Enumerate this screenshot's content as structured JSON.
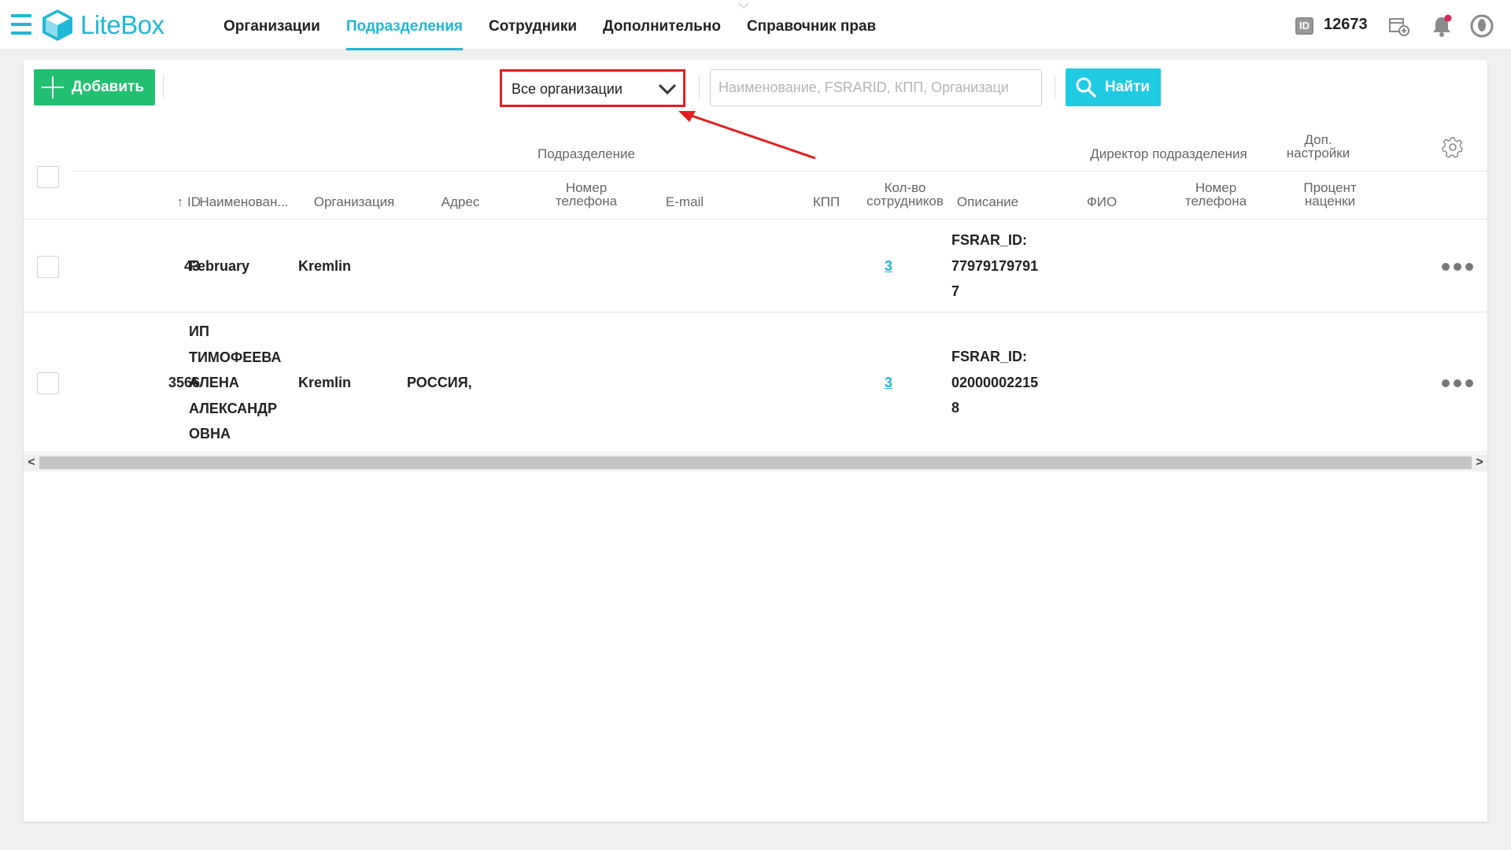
{
  "app": {
    "logo_text": "LiteBox",
    "brand_color": "#1fb8d6"
  },
  "nav": {
    "items": [
      {
        "label": "Организации"
      },
      {
        "label": "Подразделения"
      },
      {
        "label": "Сотрудники"
      },
      {
        "label": "Дополнительно"
      },
      {
        "label": "Справочник прав"
      }
    ],
    "active_index": 1
  },
  "header_right": {
    "id_badge": "ID",
    "id_value": "12673",
    "icons": [
      "add-store-icon",
      "bell-icon",
      "user-avatar-icon"
    ]
  },
  "toolbar": {
    "add_label": "Добавить",
    "org_select_value": "Все организации",
    "search_placeholder": "Наименование, FSRARID, КПП, Организаци",
    "search_value": "",
    "find_label": "Найти"
  },
  "table": {
    "groups": {
      "division": "Подразделение",
      "director": "Директор подразделения",
      "extra_1": "Доп.",
      "extra_2": "настройки"
    },
    "columns": {
      "id": "ID",
      "name": "Наименован...",
      "organization": "Организация",
      "address": "Адрес",
      "phone_1": "Номер",
      "phone_2": "телефона",
      "email": "E-mail",
      "kpp": "КПП",
      "employees_1": "Кол-во",
      "employees_2": "сотрудников",
      "description": "Описание",
      "fio": "ФИО",
      "dir_phone_1": "Номер",
      "dir_phone_2": "телефона",
      "markup_1": "Процент",
      "markup_2": "наценки"
    },
    "rows": [
      {
        "id": "43",
        "name_lines": [
          "February"
        ],
        "organization": "Kremlin",
        "address": "",
        "employees": "3",
        "description_lines": [
          "FSRAR_ID:",
          "77979179791",
          "7"
        ]
      },
      {
        "id": "3566",
        "name_lines": [
          "ИП",
          "ТИМОФЕЕВА",
          "АЛЕНА",
          "АЛЕКСАНДР",
          "ОВНА"
        ],
        "organization": "Kremlin",
        "address": "РОССИЯ,",
        "employees": "3",
        "description_lines": [
          "FSRAR_ID:",
          "02000002215",
          "8"
        ]
      }
    ]
  },
  "scrollbar": {
    "left_arrow": "<",
    "right_arrow": ">"
  },
  "colors": {
    "add_button": "#22bf71",
    "find_button": "#1fcbe2",
    "highlight": "#e41e1e"
  }
}
